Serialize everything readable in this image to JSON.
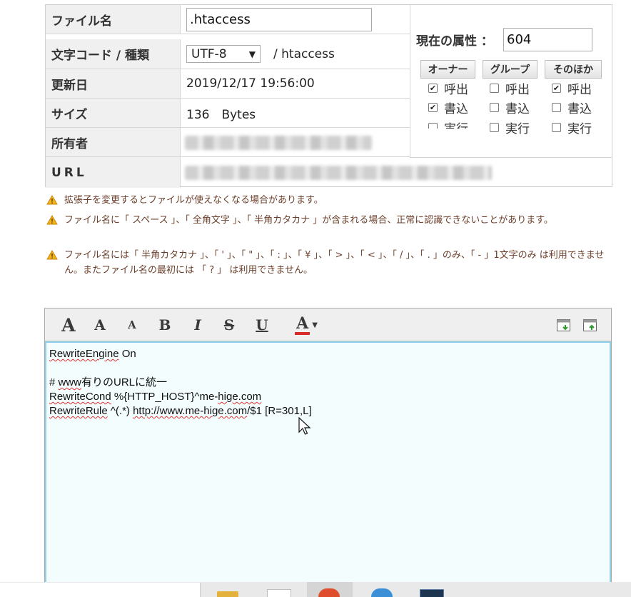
{
  "file_info": {
    "filename_label": "ファイル名",
    "filename_value": ".htaccess",
    "charset_label": "文字コード / 種類",
    "charset_value": "UTF-8",
    "file_type": "/ htaccess",
    "updated_label": "更新日",
    "updated_value": "2019/12/17 19:56:00",
    "size_label": "サイズ",
    "size_value": "136　Bytes",
    "owner_label": "所有者",
    "url_label": "URL"
  },
  "permissions": {
    "title": "現在の属性 ：",
    "value": "604",
    "groups": [
      {
        "label": "オーナー",
        "read": true,
        "write": true,
        "exec": false
      },
      {
        "label": "グループ",
        "read": false,
        "write": false,
        "exec": false
      },
      {
        "label": "そのほか",
        "read": true,
        "write": false,
        "exec": false
      }
    ],
    "read_label": "呼出",
    "write_label": "書込",
    "exec_label": "実行"
  },
  "warnings": [
    "拡張子を変更するとファイルが使えなくなる場合があります。",
    "ファイル名に「 スペース 」、「 全角文字 」、「 半角カタカナ 」が含まれる場合、正常に認識できないことがあります。",
    "ファイル名には「 半角カタカナ 」、「 ' 」、「 \" 」、「 : 」、「 ¥ 」、「 > 」、「 < 」、「 / 」、「 . 」のみ、「 - 」1文字のみ は利用できません。またファイル名の最初には 「 ? 」 は利用できません。"
  ],
  "toolbar": {
    "font_large": "A",
    "font_medium": "A",
    "font_small": "A",
    "bold": "B",
    "italic": "I",
    "strike": "S",
    "underline": "U",
    "font_color": "A"
  },
  "editor": {
    "lines": [
      {
        "a": "RewriteEngine",
        "b": " On"
      },
      {
        "a": "",
        "b": ""
      },
      {
        "a": "# ",
        "w": "www",
        "b": "有りのURLに統一"
      },
      {
        "a": "RewriteCond",
        "b": " %{HTTP_HOST}^me-",
        "w": "hige.com"
      },
      {
        "a": "RewriteRule",
        "b": " ^(.*) ",
        "w": "http://www.me-hige.com",
        "c": "/$1 [R=301,L]"
      }
    ]
  },
  "colors": {
    "accent": "#8fd0e8",
    "editor_bg": "#f3fdfe",
    "label_bg": "#f0f0f0",
    "warning_icon": "#f2b21b",
    "warning_text": "#6b3e2a",
    "font_color_bar": "#d92b2b"
  }
}
